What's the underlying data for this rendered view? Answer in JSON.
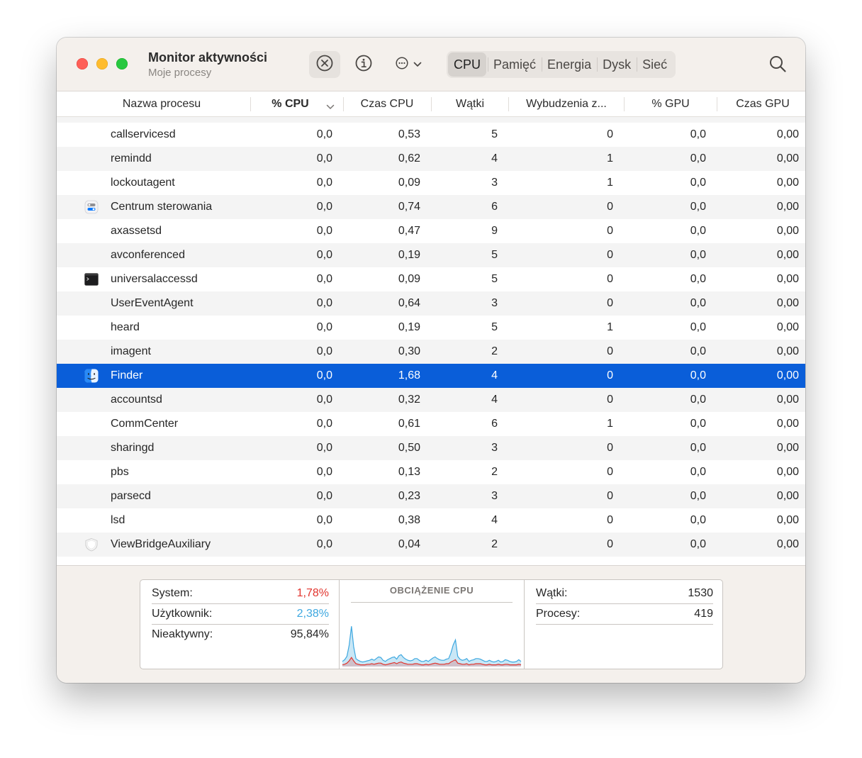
{
  "window": {
    "title": "Monitor aktywności",
    "subtitle": "Moje procesy"
  },
  "toolbar": {
    "stop_icon": "x-circle-icon",
    "info_icon": "info-icon",
    "more_icon": "ellipsis-circle-icon",
    "search_icon": "magnifying-glass-icon",
    "tabs": [
      {
        "label": "CPU",
        "active": true
      },
      {
        "label": "Pamięć",
        "active": false
      },
      {
        "label": "Energia",
        "active": false
      },
      {
        "label": "Dysk",
        "active": false
      },
      {
        "label": "Sieć",
        "active": false
      }
    ]
  },
  "table": {
    "columns": [
      "Nazwa procesu",
      "% CPU",
      "Czas CPU",
      "Wątki",
      "Wybudzenia z...",
      "% GPU",
      "Czas GPU"
    ],
    "sorted_by": "% CPU",
    "rows": [
      {
        "name": "callservicesd",
        "icon": null,
        "cpu": "0,0",
        "cpu_time": "0,53",
        "threads": "5",
        "wakeups": "0",
        "gpu": "0,0",
        "gpu_time": "0,00"
      },
      {
        "name": "remindd",
        "icon": null,
        "cpu": "0,0",
        "cpu_time": "0,62",
        "threads": "4",
        "wakeups": "1",
        "gpu": "0,0",
        "gpu_time": "0,00"
      },
      {
        "name": "lockoutagent",
        "icon": null,
        "cpu": "0,0",
        "cpu_time": "0,09",
        "threads": "3",
        "wakeups": "1",
        "gpu": "0,0",
        "gpu_time": "0,00"
      },
      {
        "name": "Centrum sterowania",
        "icon": "control-center-icon",
        "cpu": "0,0",
        "cpu_time": "0,74",
        "threads": "6",
        "wakeups": "0",
        "gpu": "0,0",
        "gpu_time": "0,00"
      },
      {
        "name": "axassetsd",
        "icon": null,
        "cpu": "0,0",
        "cpu_time": "0,47",
        "threads": "9",
        "wakeups": "0",
        "gpu": "0,0",
        "gpu_time": "0,00"
      },
      {
        "name": "avconferenced",
        "icon": null,
        "cpu": "0,0",
        "cpu_time": "0,19",
        "threads": "5",
        "wakeups": "0",
        "gpu": "0,0",
        "gpu_time": "0,00"
      },
      {
        "name": "universalaccessd",
        "icon": "terminal-icon",
        "cpu": "0,0",
        "cpu_time": "0,09",
        "threads": "5",
        "wakeups": "0",
        "gpu": "0,0",
        "gpu_time": "0,00"
      },
      {
        "name": "UserEventAgent",
        "icon": null,
        "cpu": "0,0",
        "cpu_time": "0,64",
        "threads": "3",
        "wakeups": "0",
        "gpu": "0,0",
        "gpu_time": "0,00"
      },
      {
        "name": "heard",
        "icon": null,
        "cpu": "0,0",
        "cpu_time": "0,19",
        "threads": "5",
        "wakeups": "1",
        "gpu": "0,0",
        "gpu_time": "0,00"
      },
      {
        "name": "imagent",
        "icon": null,
        "cpu": "0,0",
        "cpu_time": "0,30",
        "threads": "2",
        "wakeups": "0",
        "gpu": "0,0",
        "gpu_time": "0,00"
      },
      {
        "name": "Finder",
        "icon": "finder-icon",
        "cpu": "0,0",
        "cpu_time": "1,68",
        "threads": "4",
        "wakeups": "0",
        "gpu": "0,0",
        "gpu_time": "0,00",
        "selected": true
      },
      {
        "name": "accountsd",
        "icon": null,
        "cpu": "0,0",
        "cpu_time": "0,32",
        "threads": "4",
        "wakeups": "0",
        "gpu": "0,0",
        "gpu_time": "0,00"
      },
      {
        "name": "CommCenter",
        "icon": null,
        "cpu": "0,0",
        "cpu_time": "0,61",
        "threads": "6",
        "wakeups": "1",
        "gpu": "0,0",
        "gpu_time": "0,00"
      },
      {
        "name": "sharingd",
        "icon": null,
        "cpu": "0,0",
        "cpu_time": "0,50",
        "threads": "3",
        "wakeups": "0",
        "gpu": "0,0",
        "gpu_time": "0,00"
      },
      {
        "name": "pbs",
        "icon": null,
        "cpu": "0,0",
        "cpu_time": "0,13",
        "threads": "2",
        "wakeups": "0",
        "gpu": "0,0",
        "gpu_time": "0,00"
      },
      {
        "name": "parsecd",
        "icon": null,
        "cpu": "0,0",
        "cpu_time": "0,23",
        "threads": "3",
        "wakeups": "0",
        "gpu": "0,0",
        "gpu_time": "0,00"
      },
      {
        "name": "lsd",
        "icon": null,
        "cpu": "0,0",
        "cpu_time": "0,38",
        "threads": "4",
        "wakeups": "0",
        "gpu": "0,0",
        "gpu_time": "0,00"
      },
      {
        "name": "ViewBridgeAuxiliary",
        "icon": "shield-icon",
        "cpu": "0,0",
        "cpu_time": "0,04",
        "threads": "2",
        "wakeups": "0",
        "gpu": "0,0",
        "gpu_time": "0,00"
      }
    ]
  },
  "summary": {
    "system_label": "System:",
    "system_value": "1,78%",
    "user_label": "Użytkownik:",
    "user_value": "2,38%",
    "idle_label": "Nieaktywny:",
    "idle_value": "95,84%",
    "graph_title": "OBCIĄŻENIE CPU",
    "threads_label": "Wątki:",
    "threads_value": "1530",
    "processes_label": "Procesy:",
    "processes_value": "419"
  },
  "colors": {
    "system": "#e2352e",
    "user": "#3ea8e0",
    "selection": "#0a5ed9"
  },
  "chart_data": {
    "type": "area",
    "series": [
      {
        "name": "Użytkownik",
        "values": [
          6,
          8,
          12,
          28,
          55,
          25,
          9,
          7,
          6,
          5,
          6,
          6,
          7,
          8,
          7,
          9,
          11,
          10,
          7,
          6,
          8,
          9,
          10,
          10,
          8,
          12,
          13,
          10,
          8,
          7,
          6,
          7,
          9,
          9,
          7,
          6,
          6,
          7,
          6,
          8,
          10,
          11,
          9,
          8,
          7,
          7,
          8,
          9,
          16,
          28,
          35,
          12,
          8,
          7,
          8,
          9,
          6,
          7,
          8,
          9,
          9,
          8,
          7,
          6,
          6,
          7,
          6,
          5,
          6,
          7,
          5,
          6,
          8,
          7,
          6,
          5,
          5,
          6,
          8,
          6
        ]
      },
      {
        "name": "System",
        "values": [
          3,
          4,
          6,
          10,
          16,
          10,
          5,
          4,
          3,
          3,
          3,
          4,
          4,
          5,
          4,
          5,
          6,
          6,
          4,
          3,
          4,
          5,
          6,
          7,
          5,
          7,
          8,
          6,
          5,
          4,
          4,
          4,
          5,
          5,
          4,
          3,
          3,
          4,
          3,
          4,
          5,
          6,
          5,
          4,
          4,
          4,
          5,
          5,
          8,
          10,
          12,
          6,
          5,
          4,
          4,
          5,
          3,
          4,
          4,
          5,
          5,
          5,
          4,
          3,
          3,
          4,
          3,
          3,
          3,
          4,
          3,
          3,
          4,
          4,
          3,
          3,
          3,
          3,
          4,
          3
        ]
      }
    ],
    "ylim": [
      0,
      100
    ]
  }
}
